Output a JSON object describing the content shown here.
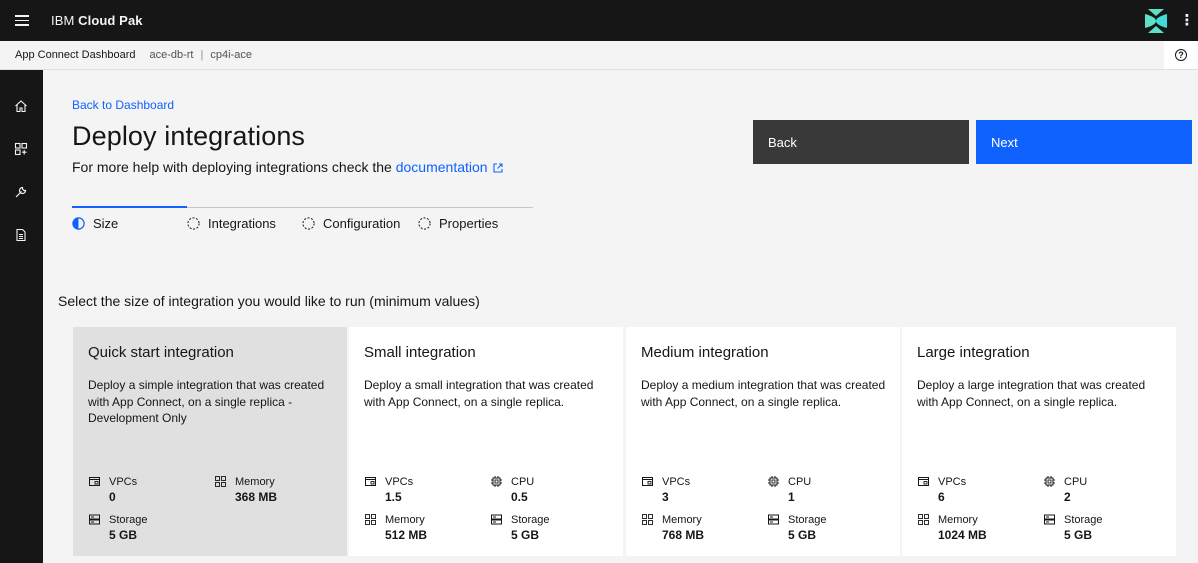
{
  "header": {
    "brand_prefix": "IBM",
    "brand_name": "Cloud Pak"
  },
  "breadcrumb": {
    "app": "App Connect Dashboard",
    "instance": "ace-db-rt",
    "separator": "|",
    "namespace": "cp4i-ace"
  },
  "main": {
    "back_link": "Back to Dashboard",
    "title": "Deploy integrations",
    "subtitle_text": "For more help with deploying integrations check the ",
    "doc_link": "documentation",
    "back_button": "Back",
    "next_button": "Next",
    "instruction": "Select the size of integration you would like to run (minimum values)"
  },
  "steps": [
    {
      "label": "Size",
      "state": "current"
    },
    {
      "label": "Integrations",
      "state": "incomplete"
    },
    {
      "label": "Configuration",
      "state": "incomplete"
    },
    {
      "label": "Properties",
      "state": "incomplete"
    }
  ],
  "tiles": [
    {
      "title": "Quick start integration",
      "description": "Deploy a simple integration that was created with App Connect, on a single replica - Development Only",
      "selected": true,
      "specs": [
        {
          "icon": "vpc-icon",
          "label": "VPCs",
          "value": "0"
        },
        {
          "icon": "memory-icon",
          "label": "Memory",
          "value": "368 MB"
        },
        {
          "icon": "storage-icon",
          "label": "Storage",
          "value": "5 GB"
        }
      ]
    },
    {
      "title": "Small integration",
      "description": "Deploy a small integration that was created with App Connect, on a single replica.",
      "selected": false,
      "specs": [
        {
          "icon": "vpc-icon",
          "label": "VPCs",
          "value": "1.5"
        },
        {
          "icon": "cpu-icon",
          "label": "CPU",
          "value": "0.5"
        },
        {
          "icon": "memory-icon",
          "label": "Memory",
          "value": "512 MB"
        },
        {
          "icon": "storage-icon",
          "label": "Storage",
          "value": "5 GB"
        }
      ]
    },
    {
      "title": "Medium integration",
      "description": "Deploy a medium integration that was created with App Connect, on a single replica.",
      "selected": false,
      "specs": [
        {
          "icon": "vpc-icon",
          "label": "VPCs",
          "value": "3"
        },
        {
          "icon": "cpu-icon",
          "label": "CPU",
          "value": "1"
        },
        {
          "icon": "memory-icon",
          "label": "Memory",
          "value": "768 MB"
        },
        {
          "icon": "storage-icon",
          "label": "Storage",
          "value": "5 GB"
        }
      ]
    },
    {
      "title": "Large integration",
      "description": "Deploy a large integration that was created with App Connect, on a single replica.",
      "selected": false,
      "specs": [
        {
          "icon": "vpc-icon",
          "label": "VPCs",
          "value": "6"
        },
        {
          "icon": "cpu-icon",
          "label": "CPU",
          "value": "2"
        },
        {
          "icon": "memory-icon",
          "label": "Memory",
          "value": "1024 MB"
        },
        {
          "icon": "storage-icon",
          "label": "Storage",
          "value": "5 GB"
        }
      ]
    }
  ],
  "colors": {
    "header_bg": "#161616",
    "primary": "#0f62fe",
    "secondary_button": "#393939",
    "page_bg": "#f4f4f4",
    "tile_selected": "#e0e0e0",
    "logo_teal": "#5ee0c4"
  },
  "icons": {
    "menu": "hamburger-menu-icon",
    "logo": "cloud-pak-logo-icon",
    "overflow": "overflow-menu-icon",
    "help": "help-icon",
    "home": "home-icon",
    "dashboard": "dashboard-icon",
    "tools": "wrench-icon",
    "docs": "document-icon",
    "external": "launch-icon"
  }
}
